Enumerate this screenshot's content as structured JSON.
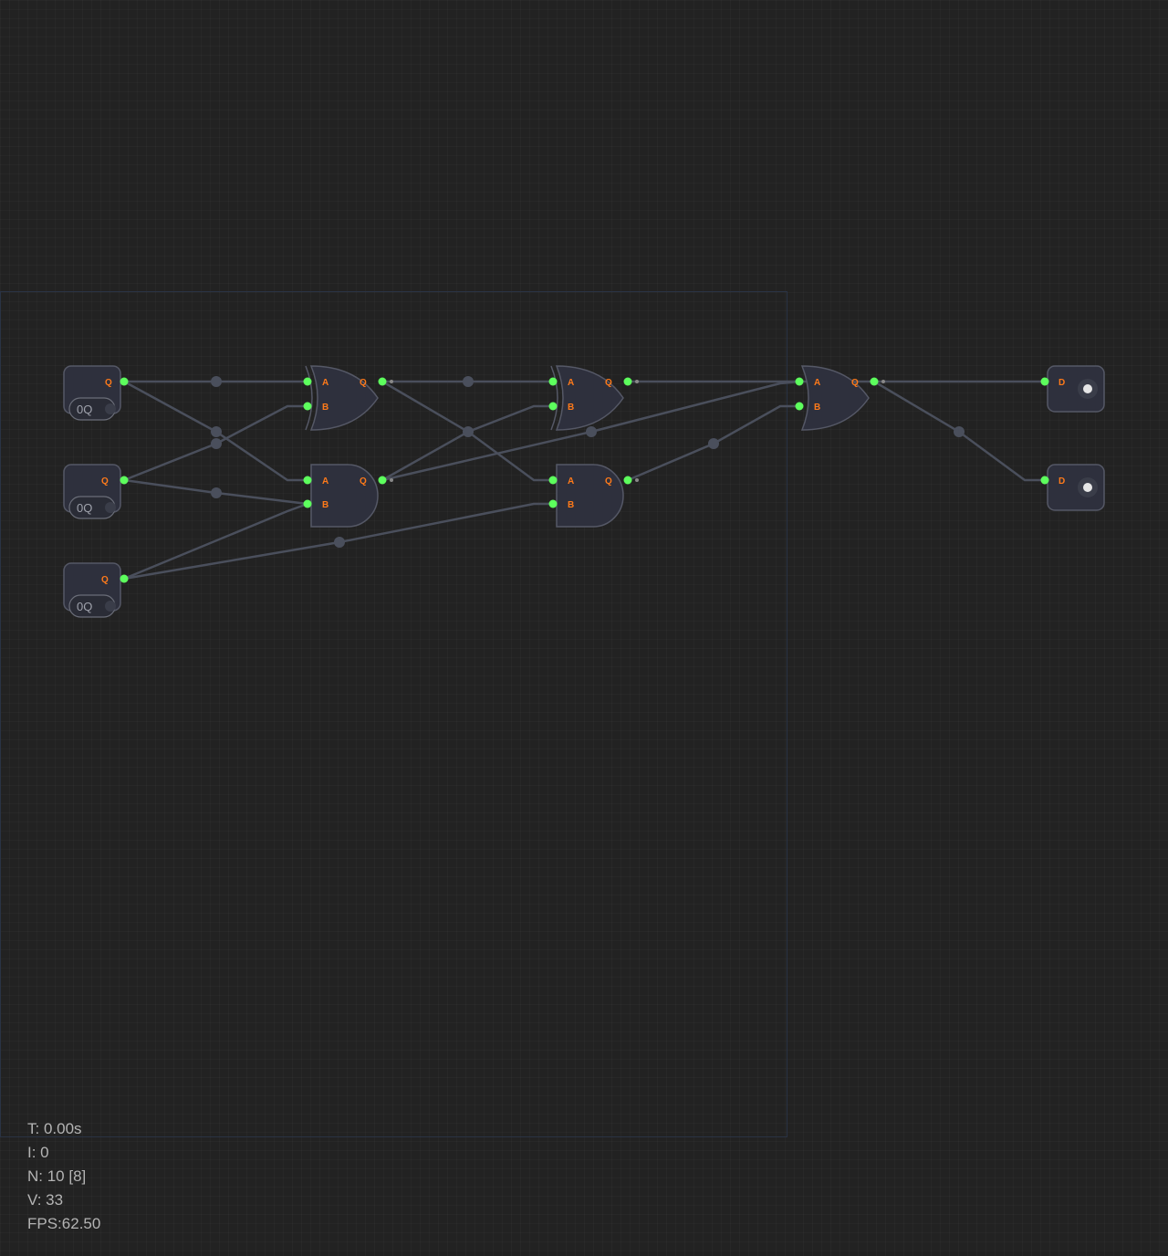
{
  "canvas": {
    "background": "#222222",
    "wire_color": "#4a4f5c",
    "pin_color": "#5dff5d",
    "node_fill": "#2e303d",
    "node_stroke": "#555866",
    "label_color": "#ff7a1a"
  },
  "inputs": [
    {
      "pin_label": "Q",
      "toggle_label": "0Q"
    },
    {
      "pin_label": "Q",
      "toggle_label": "0Q"
    },
    {
      "pin_label": "Q",
      "toggle_label": "0Q"
    }
  ],
  "gates": [
    {
      "type": "XOR",
      "in_a": "A",
      "in_b": "B",
      "out": "Q"
    },
    {
      "type": "AND",
      "in_a": "A",
      "in_b": "B",
      "out": "Q"
    },
    {
      "type": "XOR",
      "in_a": "A",
      "in_b": "B",
      "out": "Q"
    },
    {
      "type": "AND",
      "in_a": "A",
      "in_b": "B",
      "out": "Q"
    },
    {
      "type": "OR",
      "in_a": "A",
      "in_b": "B",
      "out": "Q"
    }
  ],
  "outputs": [
    {
      "pin_label": "D",
      "led_icon": "led-indicator-icon"
    },
    {
      "pin_label": "D",
      "led_icon": "led-indicator-icon"
    }
  ],
  "stats": {
    "time": "T: 0.00s",
    "iterations": "I: 0",
    "nodes": "N: 10 [8]",
    "values": "V: 33",
    "fps": "FPS:62.50"
  }
}
